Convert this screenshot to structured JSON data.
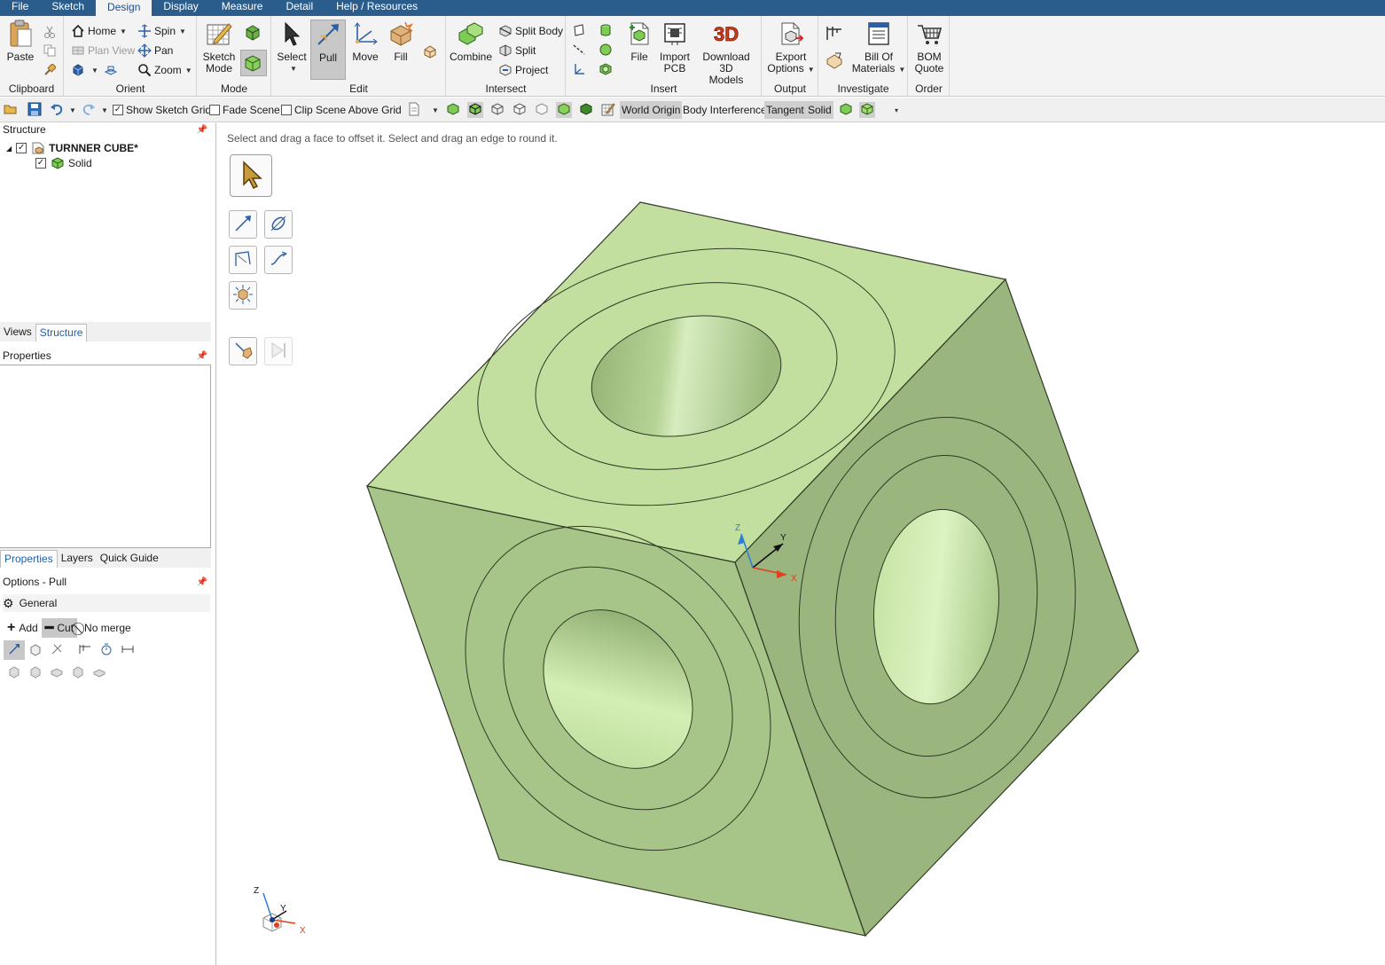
{
  "menu": {
    "tabs": [
      {
        "label": "File"
      },
      {
        "label": "Sketch"
      },
      {
        "label": "Design"
      },
      {
        "label": "Display"
      },
      {
        "label": "Measure"
      },
      {
        "label": "Detail"
      },
      {
        "label": "Help / Resources"
      }
    ],
    "active": "Design"
  },
  "ribbon": {
    "clipboard": {
      "label": "Clipboard",
      "paste": "Paste"
    },
    "orient": {
      "label": "Orient",
      "home": "Home",
      "plan_view": "Plan View",
      "spin": "Spin",
      "pan": "Pan",
      "zoom": "Zoom"
    },
    "mode": {
      "label": "Mode",
      "sketch_mode_1": "Sketch",
      "sketch_mode_2": "Mode"
    },
    "edit": {
      "label": "Edit",
      "select": "Select",
      "pull": "Pull",
      "move": "Move",
      "fill": "Fill"
    },
    "intersect": {
      "label": "Intersect",
      "combine": "Combine",
      "split_body": "Split Body",
      "split": "Split",
      "project": "Project"
    },
    "insert": {
      "label": "Insert",
      "file": "File",
      "import_pcb_1": "Import",
      "import_pcb_2": "PCB",
      "download_1": "Download 3D",
      "download_2": "Models"
    },
    "output": {
      "label": "Output",
      "export_1": "Export",
      "export_2": "Options"
    },
    "investigate": {
      "label": "Investigate",
      "bom_1": "Bill Of",
      "bom_2": "Materials"
    },
    "order": {
      "label": "Order",
      "quote_1": "BOM",
      "quote_2": "Quote"
    }
  },
  "qat": {
    "show_sketch_grid": "Show Sketch Grid",
    "fade_scene": "Fade Scene",
    "clip_scene": "Clip Scene Above Grid",
    "world_origin": "World Origin",
    "body_interference": "Body Interference",
    "tangent": "Tangent",
    "solid": "Solid",
    "check_mark": "✓"
  },
  "structure": {
    "title": "Structure",
    "root": "TURNNER CUBE*",
    "child": "Solid"
  },
  "views_tabs": {
    "views": "Views",
    "structure": "Structure"
  },
  "properties": {
    "title": "Properties"
  },
  "props_tabs": {
    "properties": "Properties",
    "layers": "Layers",
    "quick_guide": "Quick Guide"
  },
  "options": {
    "title": "Options - Pull",
    "general": "General",
    "add": "Add",
    "cut": "Cut",
    "no_merge": "No merge"
  },
  "viewport": {
    "hint": "Select and drag a face to offset it. Select and drag an edge to round it.",
    "axis_x": "X",
    "axis_y": "Y",
    "axis_z": "Z"
  },
  "colors": {
    "menubar": "#2b5d8c",
    "face_top": "#c3df9f",
    "face_left": "#a8c589",
    "face_right": "#9ab57d",
    "edge": "#2f3a24",
    "axis_x": "#e0401b",
    "axis_y": "#111111",
    "axis_z": "#2c7fd6"
  }
}
